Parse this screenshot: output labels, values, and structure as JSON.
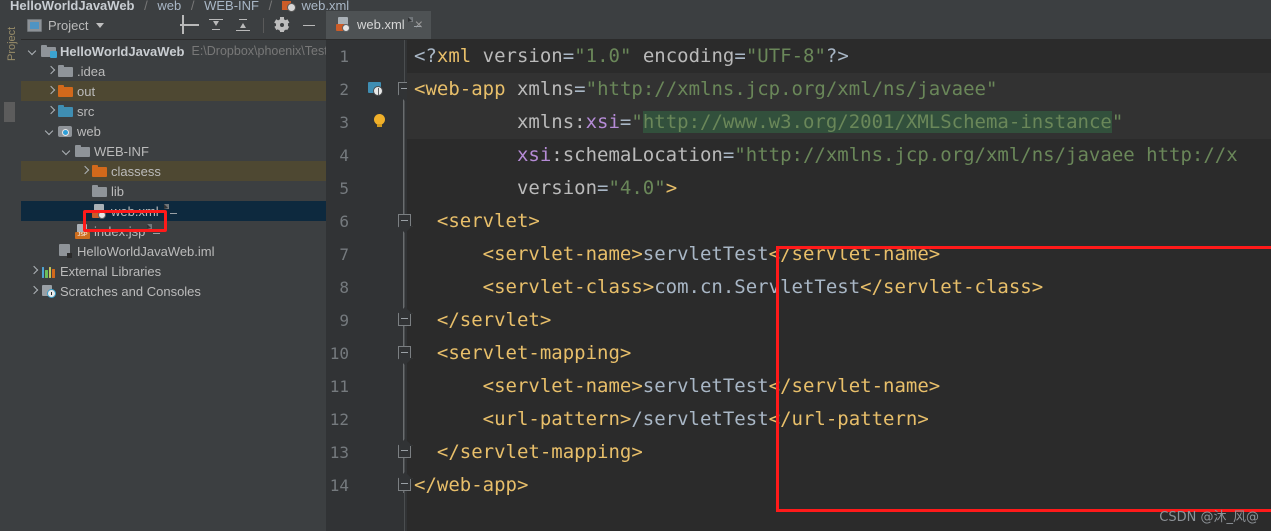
{
  "breadcrumb": {
    "items": [
      "HelloWorldJavaWeb",
      "web",
      "WEB-INF",
      "web.xml"
    ],
    "separator": "/"
  },
  "left_strip": {
    "label": "Project"
  },
  "panel": {
    "title": "Project",
    "title_caret": "▾",
    "toolbar": [
      {
        "name": "locate-icon",
        "tooltip": "Select Opened File"
      },
      {
        "name": "collapse-all-icon",
        "tooltip": "Collapse All"
      },
      {
        "name": "expand-all-icon",
        "tooltip": "Expand All"
      },
      {
        "name": "settings-gear-icon",
        "tooltip": "Settings"
      },
      {
        "name": "hide-icon",
        "tooltip": "Hide"
      }
    ],
    "tree": [
      {
        "label": "HelloWorldJavaWeb",
        "path": "E:\\Dropbox\\phoenix\\Test",
        "icon": "module-folder-icon",
        "arrow": "down",
        "indent": 0,
        "bold": true,
        "state": "normal"
      },
      {
        "label": ".idea",
        "path": "",
        "icon": "folder-gray-icon",
        "arrow": "right",
        "indent": 1,
        "bold": false,
        "state": "normal"
      },
      {
        "label": "out",
        "path": "",
        "icon": "folder-orange-icon",
        "arrow": "right",
        "indent": 1,
        "bold": false,
        "state": "highlight"
      },
      {
        "label": "src",
        "path": "",
        "icon": "folder-blue-icon",
        "arrow": "right",
        "indent": 1,
        "bold": false,
        "state": "normal"
      },
      {
        "label": "web",
        "path": "",
        "icon": "web-folder-icon",
        "arrow": "down",
        "indent": 1,
        "bold": false,
        "state": "normal"
      },
      {
        "label": "WEB-INF",
        "path": "",
        "icon": "folder-gray-icon",
        "arrow": "down",
        "indent": 2,
        "bold": false,
        "state": "normal"
      },
      {
        "label": "classess",
        "path": "",
        "icon": "folder-orange-icon",
        "arrow": "right",
        "indent": 3,
        "bold": false,
        "state": "highlight"
      },
      {
        "label": "lib",
        "path": "",
        "icon": "folder-gray-icon",
        "arrow": "none",
        "indent": 3,
        "bold": false,
        "state": "normal"
      },
      {
        "label": "web.xml",
        "path": "",
        "icon": "xml-file-icon",
        "arrow": "none",
        "indent": 3,
        "bold": false,
        "state": "selected"
      },
      {
        "label": "index.jsp",
        "path": "",
        "icon": "jsp-file-icon",
        "arrow": "none",
        "indent": 2,
        "bold": false,
        "state": "normal"
      },
      {
        "label": "HelloWorldJavaWeb.iml",
        "path": "",
        "icon": "iml-file-icon",
        "arrow": "none",
        "indent": 1,
        "bold": false,
        "state": "normal"
      },
      {
        "label": "External Libraries",
        "path": "",
        "icon": "libraries-icon",
        "arrow": "right",
        "indent": 0,
        "bold": false,
        "state": "normal"
      },
      {
        "label": "Scratches and Consoles",
        "path": "",
        "icon": "scratches-icon",
        "arrow": "right",
        "indent": 0,
        "bold": false,
        "state": "normal"
      }
    ]
  },
  "editor": {
    "tab": {
      "label": "web.xml",
      "icon": "xml-file-icon",
      "close": "×"
    },
    "line_numbers": [
      "1",
      "2",
      "3",
      "4",
      "5",
      "6",
      "7",
      "8",
      "9",
      "10",
      "11",
      "12",
      "13",
      "14"
    ],
    "code": [
      {
        "n": "1",
        "parts": [
          {
            "t": "punct",
            "v": "<?"
          },
          {
            "t": "tag",
            "v": "xml"
          },
          {
            "t": "txt",
            "v": " "
          },
          {
            "t": "attr",
            "v": "version"
          },
          {
            "t": "punct",
            "v": "="
          },
          {
            "t": "str",
            "v": "\"1.0\""
          },
          {
            "t": "txt",
            "v": " "
          },
          {
            "t": "attr",
            "v": "encoding"
          },
          {
            "t": "punct",
            "v": "="
          },
          {
            "t": "str",
            "v": "\"UTF-8\""
          },
          {
            "t": "punct",
            "v": "?>"
          }
        ]
      },
      {
        "n": "2",
        "parts": [
          {
            "t": "tag",
            "v": "<web-app"
          },
          {
            "t": "txt",
            "v": " "
          },
          {
            "t": "attr",
            "v": "xmlns"
          },
          {
            "t": "punct",
            "v": "="
          },
          {
            "t": "str",
            "v": "\"http://xmlns.jcp.org/xml/ns/javaee\""
          }
        ]
      },
      {
        "n": "3",
        "parts": [
          {
            "t": "txt",
            "v": "         "
          },
          {
            "t": "attr",
            "v": "xmlns:"
          },
          {
            "t": "ns",
            "v": "xsi"
          },
          {
            "t": "punct",
            "v": "="
          },
          {
            "t": "str",
            "v": "\""
          },
          {
            "t": "strhl",
            "v": "http://www.w3.org/2001/XMLSchema-instance"
          },
          {
            "t": "str",
            "v": "\""
          }
        ]
      },
      {
        "n": "4",
        "parts": [
          {
            "t": "txt",
            "v": "         "
          },
          {
            "t": "ns",
            "v": "xsi"
          },
          {
            "t": "attr",
            "v": ":schemaLocation"
          },
          {
            "t": "punct",
            "v": "="
          },
          {
            "t": "str",
            "v": "\"http://xmlns.jcp.org/xml/ns/javaee http://x"
          }
        ]
      },
      {
        "n": "5",
        "parts": [
          {
            "t": "txt",
            "v": "         "
          },
          {
            "t": "attr",
            "v": "version"
          },
          {
            "t": "punct",
            "v": "="
          },
          {
            "t": "str",
            "v": "\"4.0\""
          },
          {
            "t": "tag",
            "v": ">"
          }
        ]
      },
      {
        "n": "6",
        "parts": [
          {
            "t": "txt",
            "v": "  "
          },
          {
            "t": "tag",
            "v": "<servlet>"
          }
        ]
      },
      {
        "n": "7",
        "parts": [
          {
            "t": "txt",
            "v": "      "
          },
          {
            "t": "tag",
            "v": "<servlet-name>"
          },
          {
            "t": "txt",
            "v": "servletTest"
          },
          {
            "t": "tag",
            "v": "</servlet-name>"
          }
        ]
      },
      {
        "n": "8",
        "parts": [
          {
            "t": "txt",
            "v": "      "
          },
          {
            "t": "tag",
            "v": "<servlet-class>"
          },
          {
            "t": "txt",
            "v": "com.cn.ServletTest"
          },
          {
            "t": "tag",
            "v": "</servlet-class>"
          }
        ]
      },
      {
        "n": "9",
        "parts": [
          {
            "t": "txt",
            "v": "  "
          },
          {
            "t": "tag",
            "v": "</servlet>"
          }
        ]
      },
      {
        "n": "10",
        "parts": [
          {
            "t": "txt",
            "v": "  "
          },
          {
            "t": "tag",
            "v": "<servlet-mapping>"
          }
        ]
      },
      {
        "n": "11",
        "parts": [
          {
            "t": "txt",
            "v": "      "
          },
          {
            "t": "tag",
            "v": "<servlet-name>"
          },
          {
            "t": "txt",
            "v": "servletTest"
          },
          {
            "t": "tag",
            "v": "</servlet-name>"
          }
        ]
      },
      {
        "n": "12",
        "parts": [
          {
            "t": "txt",
            "v": "      "
          },
          {
            "t": "tag",
            "v": "<url-pattern>"
          },
          {
            "t": "txt",
            "v": "/servletTest"
          },
          {
            "t": "tag",
            "v": "</url-pattern>"
          }
        ]
      },
      {
        "n": "13",
        "parts": [
          {
            "t": "txt",
            "v": "  "
          },
          {
            "t": "tag",
            "v": "</servlet-mapping>"
          }
        ]
      },
      {
        "n": "14",
        "parts": [
          {
            "t": "tag",
            "v": "</web-app>"
          }
        ]
      }
    ],
    "fold_markers": [
      {
        "line": 2,
        "type": "open"
      },
      {
        "line": 6,
        "type": "open"
      },
      {
        "line": 9,
        "type": "close"
      },
      {
        "line": 10,
        "type": "open"
      },
      {
        "line": 13,
        "type": "close"
      },
      {
        "line": 14,
        "type": "close"
      }
    ],
    "gutter_icons": [
      {
        "line": 2,
        "name": "web-descriptor-icon"
      },
      {
        "line": 3,
        "name": "intention-bulb-icon"
      }
    ]
  },
  "annotations": {
    "highlight_color": "#ff1a1a",
    "code_box_label": "servlet-and-mapping-highlight",
    "tree_box_label": "web-xml-file-highlight"
  },
  "watermark": {
    "text": "CSDN @沐_风@"
  },
  "colors": {
    "editor_background": "#2b2b2b",
    "panel_background": "#3c3f41",
    "selection": "#0d293e",
    "tag": "#e8bf6a",
    "string": "#6a8759",
    "namespace": "#b58bd6",
    "text": "#a9b7c6",
    "highlight_row": "#4e4832"
  }
}
